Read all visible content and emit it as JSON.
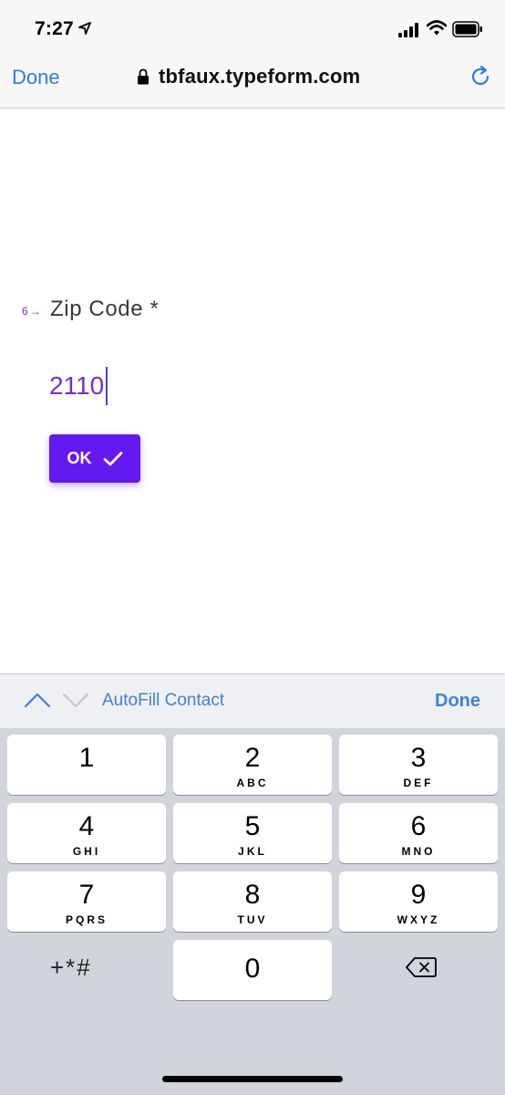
{
  "status_bar": {
    "time": "7:27",
    "icons": [
      "location-arrow-icon",
      "signal-icon",
      "wifi-icon",
      "battery-icon"
    ]
  },
  "browser": {
    "done_label": "Done",
    "url": "tbfaux.typeform.com",
    "icons": [
      "lock-icon",
      "reload-icon"
    ],
    "accent_color": "#2b7de1"
  },
  "form": {
    "question_number": "6",
    "question_label": "Zip Code *",
    "answer_value": "2110",
    "ok_label": "OK",
    "accent_color": "#6419f0",
    "question_color": "#7a2ccf"
  },
  "accessory": {
    "autofill_label": "AutoFill Contact",
    "done_label": "Done",
    "icons": [
      "chevron-up-icon",
      "chevron-down-icon"
    ]
  },
  "keypad": {
    "keys": [
      {
        "digit": "1",
        "letters": ""
      },
      {
        "digit": "2",
        "letters": "ABC"
      },
      {
        "digit": "3",
        "letters": "DEF"
      },
      {
        "digit": "4",
        "letters": "GHI"
      },
      {
        "digit": "5",
        "letters": "JKL"
      },
      {
        "digit": "6",
        "letters": "MNO"
      },
      {
        "digit": "7",
        "letters": "PQRS"
      },
      {
        "digit": "8",
        "letters": "TUV"
      },
      {
        "digit": "9",
        "letters": "WXYZ"
      },
      {
        "digit": "0",
        "letters": ""
      }
    ],
    "symbols_label": "+*#",
    "icons": [
      "delete-icon"
    ]
  }
}
